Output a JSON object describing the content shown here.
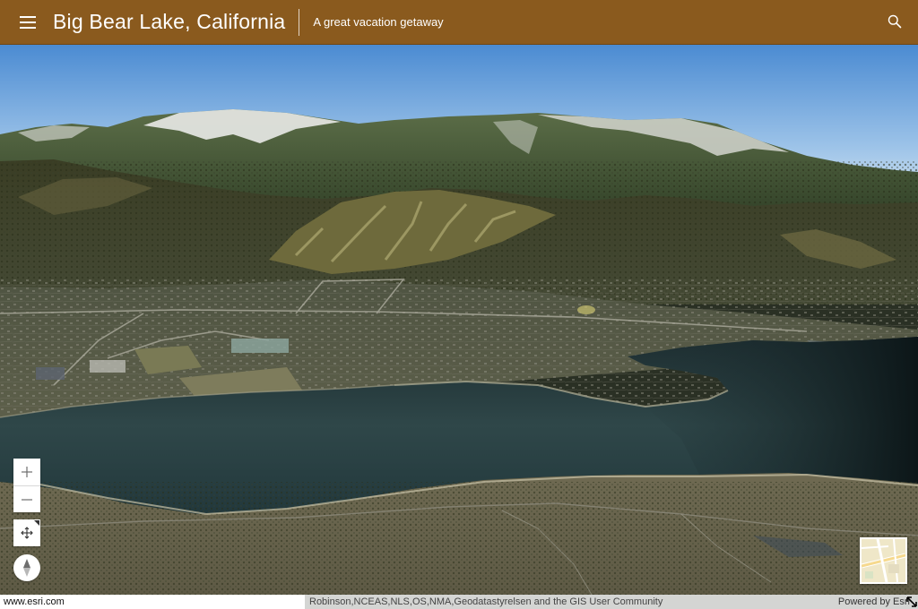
{
  "header": {
    "title": "Big Bear Lake, California",
    "subtitle": "A great vacation getaway",
    "menu_icon": "hamburger-menu-icon",
    "search_icon": "search-icon",
    "background": "#8a5a1e"
  },
  "controls": {
    "zoom_in_label": "+",
    "zoom_out_label": "–",
    "pan_icon": "move-arrows-icon",
    "compass_icon": "compass-icon",
    "basemap_icon": "basemap-toggle-thumbnail"
  },
  "attribution": {
    "link": "www.esri.com",
    "sources": "Robinson,NCEAS,NLS,OS,NMA,Geodatastyrelsen and the GIS User Community",
    "powered_by": "Powered by Esri"
  }
}
